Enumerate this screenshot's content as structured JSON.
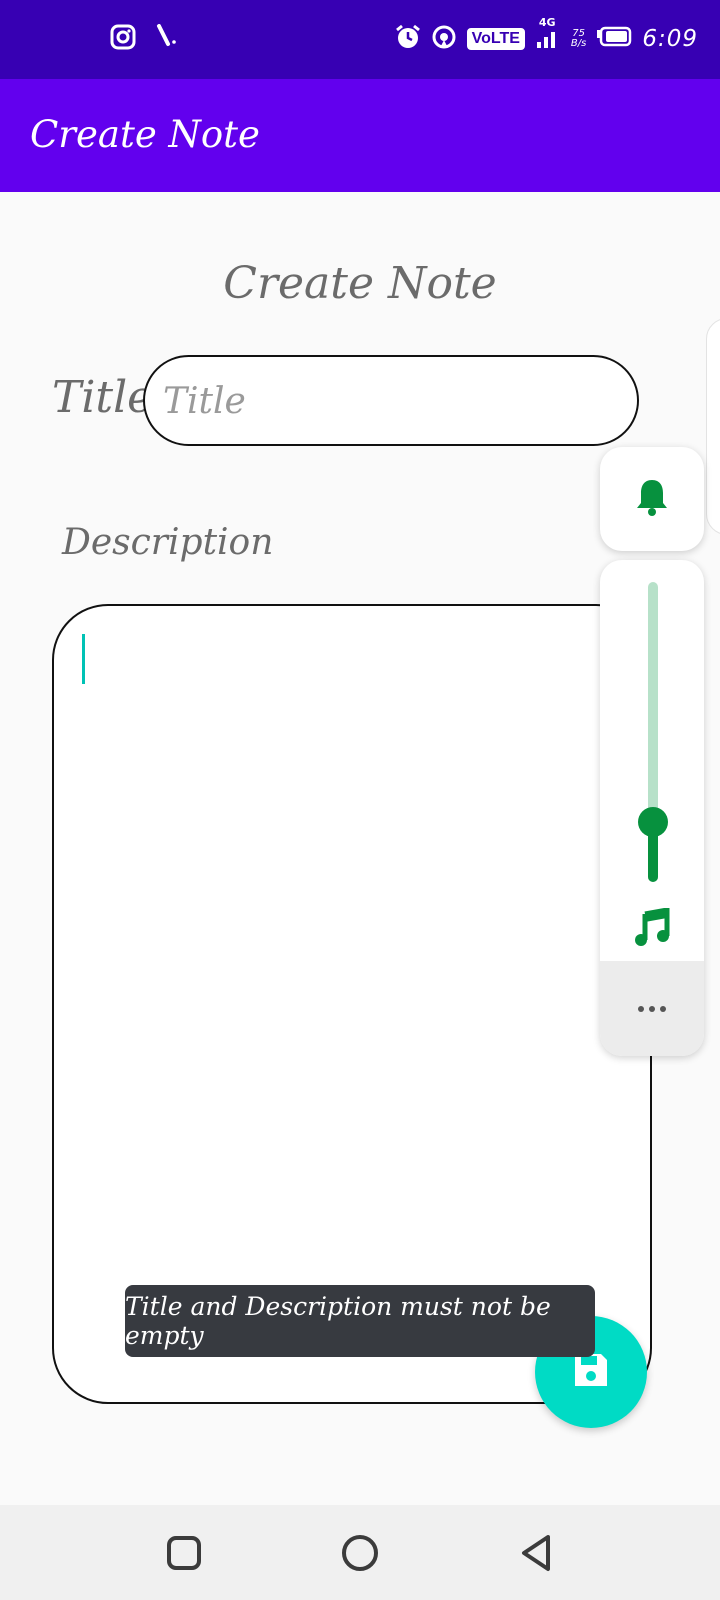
{
  "status_bar": {
    "time": "6:09",
    "network_badge": "VoLTE",
    "network_gen": "4G",
    "speed_value": "75",
    "speed_unit": "B/s",
    "icons": [
      "instagram-icon",
      "signal-slash-icon",
      "alarm-icon",
      "hotspot-icon",
      "signal-icon",
      "battery-icon"
    ]
  },
  "app_bar": {
    "title": "Create Note"
  },
  "form": {
    "heading": "Create Note",
    "title_label": "Title",
    "title_placeholder": "Title",
    "title_value": "",
    "description_label": "Description",
    "description_value": ""
  },
  "volume_panel": {
    "level": 0.2,
    "accent_color": "#07913e",
    "icons": [
      "bell-icon",
      "music-note-icon",
      "more-icon"
    ]
  },
  "toast": {
    "message": "Title and Description must not be empty"
  },
  "fab": {
    "icon": "save-icon",
    "color": "#00dbc5"
  },
  "colors": {
    "status_bar": "#3700b3",
    "app_bar": "#6200ee"
  },
  "nav_bar": {
    "icons": [
      "recents-icon",
      "home-icon",
      "back-icon"
    ]
  }
}
